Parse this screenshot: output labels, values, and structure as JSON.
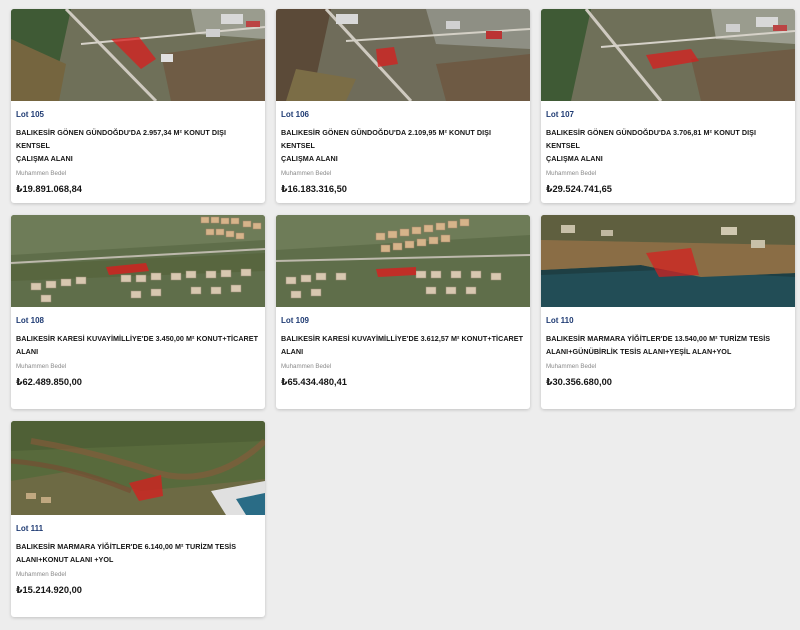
{
  "lots": [
    {
      "lot": "Lot 105",
      "title_l1": "BALIKESİR GÖNEN GÜNDOĞDU'DA 2.957,34 M² KONUT DIŞI KENTSEL",
      "title_l2": "ÇALIŞMA ALANI",
      "price_label": "Muhammen Bedel",
      "price": "₺19.891.068,84"
    },
    {
      "lot": "Lot 106",
      "title_l1": "BALIKESİR GÖNEN GÜNDOĞDU'DA 2.109,95 M² KONUT DIŞI KENTSEL",
      "title_l2": "ÇALIŞMA ALANI",
      "price_label": "Muhammen Bedel",
      "price": "₺16.183.316,50"
    },
    {
      "lot": "Lot 107",
      "title_l1": "BALIKESİR GÖNEN GÜNDOĞDU'DA 3.706,81 M² KONUT DIŞI KENTSEL",
      "title_l2": "ÇALIŞMA ALANI",
      "price_label": "Muhammen Bedel",
      "price": "₺29.524.741,65"
    },
    {
      "lot": "Lot 108",
      "title_l1": "BALIKESİR KARESİ KUVAYİMİLLİYE'DE 3.450,00 M² KONUT+TİCARET ALANI",
      "title_l2": "",
      "price_label": "Muhammen Bedel",
      "price": "₺62.489.850,00"
    },
    {
      "lot": "Lot 109",
      "title_l1": "BALIKESİR KARESİ KUVAYİMİLLİYE'DE 3.612,57 M² KONUT+TİCARET ALANI",
      "title_l2": "",
      "price_label": "Muhammen Bedel",
      "price": "₺65.434.480,41"
    },
    {
      "lot": "Lot 110",
      "title_l1": "BALIKESİR MARMARA YİĞİTLER'DE 13.540,00 M² TURİZM TESİS",
      "title_l2": "ALANI+GÜNÜBİRLİK TESİS ALANI+YEŞİL ALAN+YOL",
      "price_label": "Muhammen Bedel",
      "price": "₺30.356.680,00"
    },
    {
      "lot": "Lot 111",
      "title_l1": "BALIKESİR MARMARA YİĞİTLER'DE 6.140,00 M² TURİZM TESİS",
      "title_l2": "ALANI+KONUT ALANI +YOL",
      "price_label": "Muhammen Bedel",
      "price": "₺15.214.920,00"
    }
  ],
  "colors": {
    "lot_blue": "#1f3b73",
    "parcel_red": "#d81e1e",
    "page_bg": "#ededed"
  }
}
